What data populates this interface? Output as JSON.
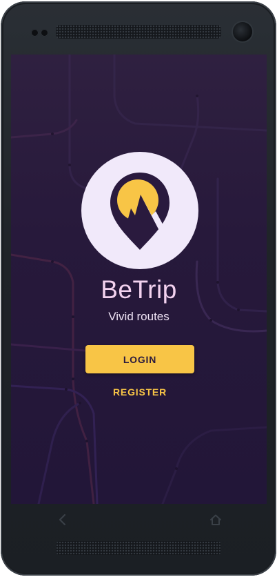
{
  "app": {
    "name": "BeTrip",
    "tagline": "Vivid routes"
  },
  "actions": {
    "login_label": "LOGIN",
    "register_label": "REGISTER"
  },
  "icons": {
    "logo": "map-pin-mountain-sun-icon",
    "back": "back-arrow-icon",
    "home": "home-icon"
  },
  "colors": {
    "background": "#27193b",
    "accent": "#f8c546",
    "logo_circle": "#f1e9fa",
    "logo_pin": "#2a1a3e",
    "title": "#f3d2ef"
  }
}
